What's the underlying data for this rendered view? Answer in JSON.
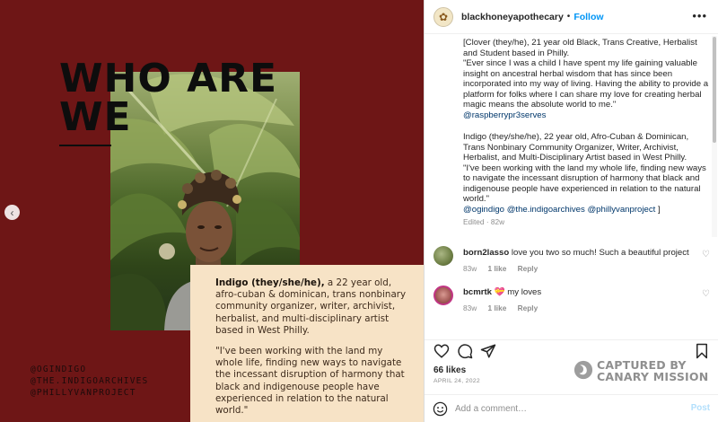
{
  "post_image": {
    "headline": "WHO ARE WE",
    "card": {
      "name": "Indigo (they/she/he),",
      "bio": " a 22 year old, afro-cuban & dominican, trans nonbinary community organizer, writer, archivist, herbalist, and multi-disciplinary artist based in West Philly.",
      "quote": "\"I've been working with the land my whole life, finding new ways to navigate the incessant disruption of harmony that black and indigenouse people have experienced in relation to the natural world.\""
    },
    "handles": [
      "@OGINDIGO",
      "@THE.INDIGOARCHIVES",
      "@PHILLYVANPROJECT"
    ],
    "prev_icon": "chevron-left-icon"
  },
  "header": {
    "username": "blackhoneyapothecary",
    "separator": "•",
    "follow_label": "Follow",
    "options_icon": "more-horizontal-icon"
  },
  "caption": {
    "para1": "[Clover (they/he), 21 year old Black, Trans Creative, Herbalist and Student based in Philly.",
    "para1_quote": "\"Ever since I was a child I have spent my life gaining valuable insight on ancestral herbal wisdom that has since been incorporated into my way of living. Having the ability to provide a platform for folks where I can share my love for creating herbal magic means the absolute world to me.\"",
    "mention1": "@raspberrypr3serves",
    "para2": "Indigo (they/she/he), 22 year old, Afro-Cuban & Dominican, Trans Nonbinary Community Organizer, Writer, Archivist, Herbalist, and Multi-Disciplinary Artist based in West Philly.",
    "para2_quote": "\"I've been working with the land my whole life, finding new ways to navigate the incessant disruption of harmony that black and indigenouse people have experienced in relation to the natural world.\"",
    "mention2a": "@ogindigo",
    "mention2b": "@the.indigoarchives",
    "mention2c": "@phillyvanproject",
    "closing": " ]",
    "edited": "Edited · 82w"
  },
  "comments": [
    {
      "user": "born2lasso",
      "text": "love you two so much! Such a beautiful project",
      "age": "83w",
      "likes": "1 like",
      "reply": "Reply"
    },
    {
      "user": "bcmrtk",
      "emoji": "💝",
      "text": "my loves",
      "age": "83w",
      "likes": "1 like",
      "reply": "Reply"
    }
  ],
  "actions": {
    "likes": "66 likes",
    "date": "APRIL 24, 2022",
    "icons": [
      "heart-icon",
      "comment-icon",
      "share-icon",
      "bookmark-icon"
    ]
  },
  "watermark": {
    "line1": "CAPTURED BY",
    "line2": "CANARY MISSION",
    "icon": "canary-mission-logo"
  },
  "comment_bar": {
    "placeholder": "Add a comment…",
    "post_label": "Post",
    "emoji_icon": "emoji-icon"
  },
  "colors": {
    "image_background": "#6e1616",
    "card_background": "#f7e3c6",
    "follow_blue": "#0095f6",
    "mention_blue": "#00376b"
  }
}
